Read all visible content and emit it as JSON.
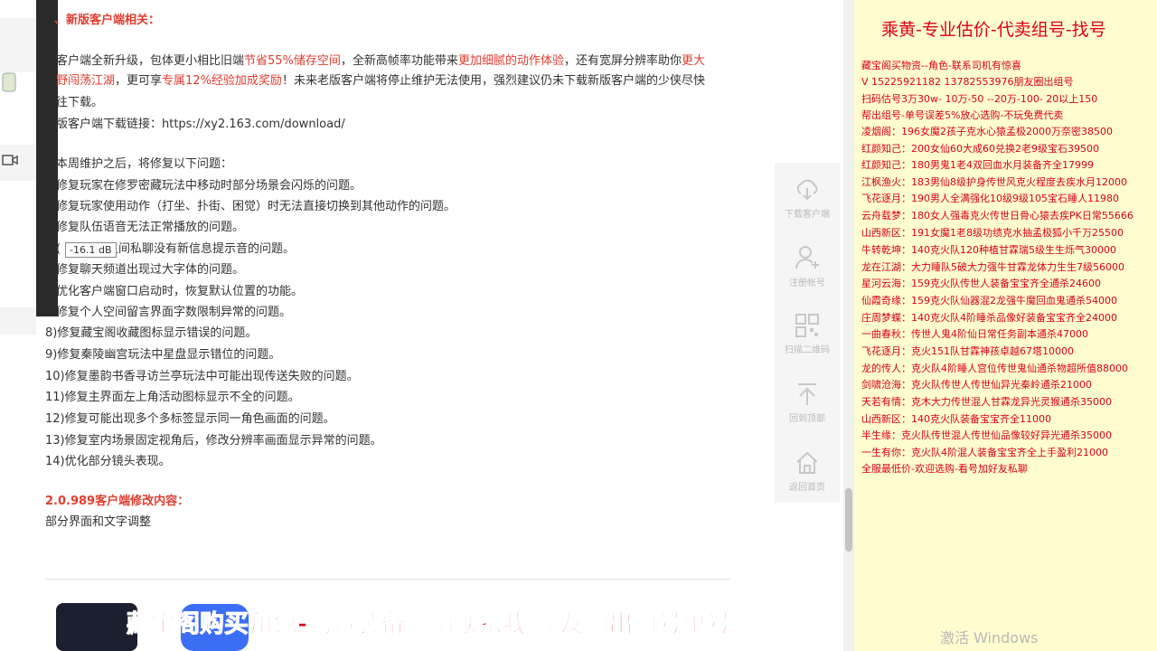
{
  "article": {
    "section_new_client_title": "、新版客户端相关：",
    "p1_a": "客户端全新升级，包体更小相比旧端",
    "p1_b": "节省55%储存空间",
    "p1_c": "，全新高帧率功能带来",
    "p1_d": "更加细腻的动作体验",
    "p1_e": "，还有宽屏分辨率助你",
    "p1_f": "更大",
    "p2_a": "野闯荡江湖",
    "p2_b": "，更可享",
    "p2_c": "专属12%经验加成奖励",
    "p2_d": "！未来老版客户端将停止维护无法使用，强烈建议仍未下载新版客户端的少侠尽快",
    "p3": "往下载。",
    "download": "版客户端下载链接：https://xy2.163.com/download/",
    "fix_intro": "本周维护之后，将修复以下问题：",
    "fixes": [
      "修复玩家在修罗密藏玩法中移动时部分场景会闪烁的问题。",
      "修复玩家使用动作（打坐、扑街、困觉）时无法直接切换到其他动作的问题。",
      "修复队伍语音无法正常播放的问题。",
      "之间私聊没有新信息提示音的问题。",
      "修复聊天频道出现过大字体的问题。",
      "优化客户端窗口启动时，恢复默认位置的功能。",
      "修复个人空间留言界面字数限制异常的问题。",
      "8)修复藏宝阁收藏图标显示错误的问题。",
      "9)修复秦陵幽宫玩法中星盘显示错位的问题。",
      "10)修复墨韵书香寻访兰亭玩法中可能出现传送失败的问题。",
      "11)修复主界面左上角活动图标显示不全的问题。",
      "12)修复可能出现多个多标签显示同一角色画面的问题。",
      "13)修复室内场景固定视角后，修改分辨率画面显示异常的问题。",
      "14)优化部分镜头表现。"
    ],
    "fix4_prefix": "(",
    "version_title": "2.0.989客户端修改内容：",
    "version_body": "部分界面和文字调整"
  },
  "tooltip": "-16.1 dB",
  "sidebar": {
    "download": "下载客户端",
    "register": "注册帐号",
    "qrcode": "扫描二维码",
    "top": "回到顶部",
    "home": "返回首页"
  },
  "right_panel": {
    "title": "乘黄-专业估价-代卖组号-找号",
    "lines": [
      "藏宝阁买物资--角色-联系司机有惊喜",
      "V  15225921182   13782553976朋友圈出组号",
      "扫码估号3万30w- 10万-50 --20万-100- 20以上150",
      "帮出组号-单号误差5%放心选购-不玩免费代卖",
      "凌烟阁：196女魔2孩子克水心猿孟极2000万奈密38500",
      "红颜知己：200女仙60大成60兑换2老9级宝石39500",
      "红颜知己：180男鬼1老4双回血水月装备齐全17999",
      "江枫渔火：183男仙8级护身传世风克火程度去疾水月12000",
      "飞花逐月：190男人全满强化10级9级105宝石睡人11980",
      "云舟载梦：180女人强毒克火传世日骨心猿去疾PK日常55666",
      "山西新区：191女魔1老8级功绩克水抽孟极狐小千万25500",
      "牛转乾坤：140克火队120种植甘霖瑞5级生生烁气30000",
      "龙在江湖：大力睡队5破大力强牛甘霖龙体力生生7级56000",
      "星河云海：159克火队传世人装备宝宝齐全通杀24600",
      "仙霞奇缘：159克火队仙器混2龙强牛魔回血鬼通杀54000",
      "庄周梦蝶：140克火队4阶睡杀品像好装备宝宝齐全24000",
      "一曲春秋：传世人鬼4阶仙日常任务副本通杀47000",
      "飞花逐月：克火151队甘霖神孩卓越67塔10000",
      "龙的传人：克火队4阶睡人宫位传世鬼仙通杀物超所值88000",
      "剑啸沧海：克火队传世人传世仙异光秦岭通杀21000",
      "天若有情：克木大力传世混人甘霖龙异光灵猴通杀35000",
      "山西新区：140克火队装备宝宝齐全11000",
      "半生缘：克火队传世混人传世仙品像较好异光通杀35000",
      "一生有你：克火队4阶混人装备宝宝齐全上手盈利21000",
      "全服最低价-欢迎选购-看号加好友私聊"
    ]
  },
  "banner": "藏宝阁购买角色-物资装备提前联系我      朋友圈出组号单号",
  "watermark": "激活 Windows"
}
